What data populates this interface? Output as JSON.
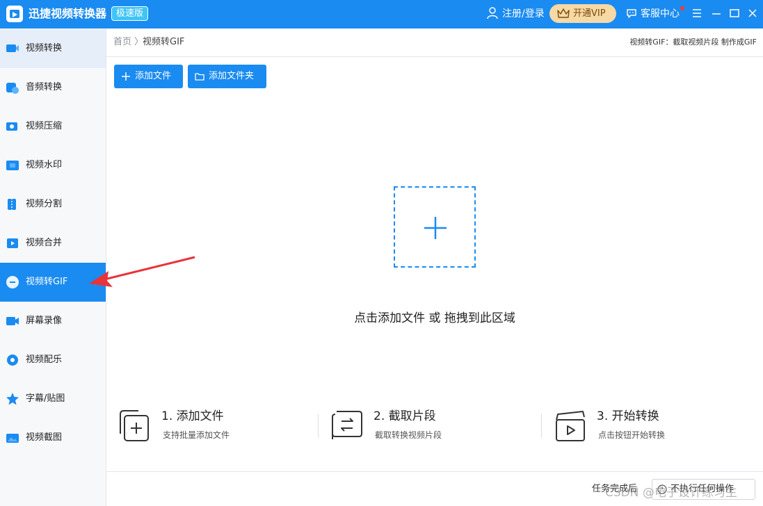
{
  "window": {
    "title": "迅捷视频转换器",
    "edition": "极速版",
    "register_login": "注册/登录",
    "vip_label": "开通VIP",
    "support_label": "客服中心",
    "controls": [
      "menu-icon",
      "minimize-icon",
      "maximize-icon",
      "close-icon"
    ]
  },
  "sidebar": {
    "items": [
      {
        "label": "视频转换",
        "icon": "video-convert-icon"
      },
      {
        "label": "音频转换",
        "icon": "audio-convert-icon"
      },
      {
        "label": "视频压缩",
        "icon": "video-compress-icon"
      },
      {
        "label": "视频水印",
        "icon": "video-watermark-icon"
      },
      {
        "label": "视频分割",
        "icon": "video-split-icon"
      },
      {
        "label": "视频合并",
        "icon": "video-merge-icon"
      },
      {
        "label": "视频转GIF",
        "icon": "video-gif-icon"
      },
      {
        "label": "屏幕录像",
        "icon": "screen-record-icon"
      },
      {
        "label": "视频配乐",
        "icon": "video-music-icon"
      },
      {
        "label": "字幕/贴图",
        "icon": "subtitle-sticker-icon"
      },
      {
        "label": "视频截图",
        "icon": "video-screenshot-icon"
      }
    ],
    "selected": "视频转GIF"
  },
  "breadcrumb": {
    "home": "首页",
    "separator": "〉",
    "current": "视频转GIF"
  },
  "page_description": "视频转GIF：截取视频片段 制作成GIF",
  "toolbar": {
    "add_file": "添加文件",
    "add_folder": "添加文件夹"
  },
  "dropzone": {
    "hint": "点击添加文件 或 拖拽到此区域"
  },
  "steps": [
    {
      "title": "1. 添加文件",
      "desc": "支持批量添加文件"
    },
    {
      "title": "2. 截取片段",
      "desc": "截取转换视频片段"
    },
    {
      "title": "3. 开始转换",
      "desc": "点击按钮开始转换"
    }
  ],
  "footer": {
    "after_label": "任务完成后",
    "after_value": "不执行任何操作"
  },
  "watermark": "CSDN @电子设计练习生",
  "colors": {
    "brand": "#1a8bf0",
    "vip_bg": "#f6d9a5",
    "edition_badge": "#3fc4f6",
    "annotation": "#e8333a"
  }
}
